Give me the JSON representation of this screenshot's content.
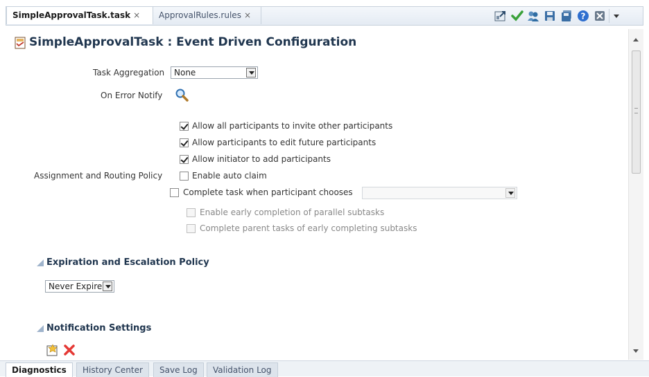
{
  "tabs": [
    {
      "label": "SimpleApprovalTask.task",
      "active": true
    },
    {
      "label": "ApprovalRules.rules",
      "active": false
    }
  ],
  "toolbar_icons": [
    "export-icon",
    "validate-check-icon",
    "users-icon",
    "save-icon",
    "save-all-icon",
    "help-icon",
    "close-icon",
    "dropdown-arrow-icon"
  ],
  "page": {
    "title": "SimpleApprovalTask : Event Driven Configuration"
  },
  "task_aggregation": {
    "label": "Task Aggregation",
    "value": "None"
  },
  "on_error_notify": {
    "label": "On Error Notify"
  },
  "assignment": {
    "label": "Assignment and Routing Policy",
    "options": [
      {
        "label": "Allow all participants to invite other participants",
        "checked": true
      },
      {
        "label": "Allow participants to edit future participants",
        "checked": true
      },
      {
        "label": "Allow initiator to add participants",
        "checked": true
      },
      {
        "label": "Enable auto claim",
        "checked": false
      },
      {
        "label": "Complete task when participant chooses",
        "checked": false
      },
      {
        "label": "Enable early completion of parallel subtasks",
        "checked": false,
        "disabled": true
      },
      {
        "label": "Complete parent tasks of early completing subtasks",
        "checked": false,
        "disabled": true
      }
    ],
    "participant_choice_value": ""
  },
  "expiration": {
    "heading": "Expiration and Escalation Policy",
    "value": "Never Expire"
  },
  "notification": {
    "heading": "Notification Settings"
  },
  "bottom_tabs": [
    {
      "label": "Diagnostics",
      "active": true
    },
    {
      "label": "History Center",
      "active": false
    },
    {
      "label": "Save Log",
      "active": false
    },
    {
      "label": "Validation Log",
      "active": false
    }
  ],
  "colors": {
    "heading": "#20364f",
    "accent": "#2e7d32",
    "delete": "#e53935"
  }
}
